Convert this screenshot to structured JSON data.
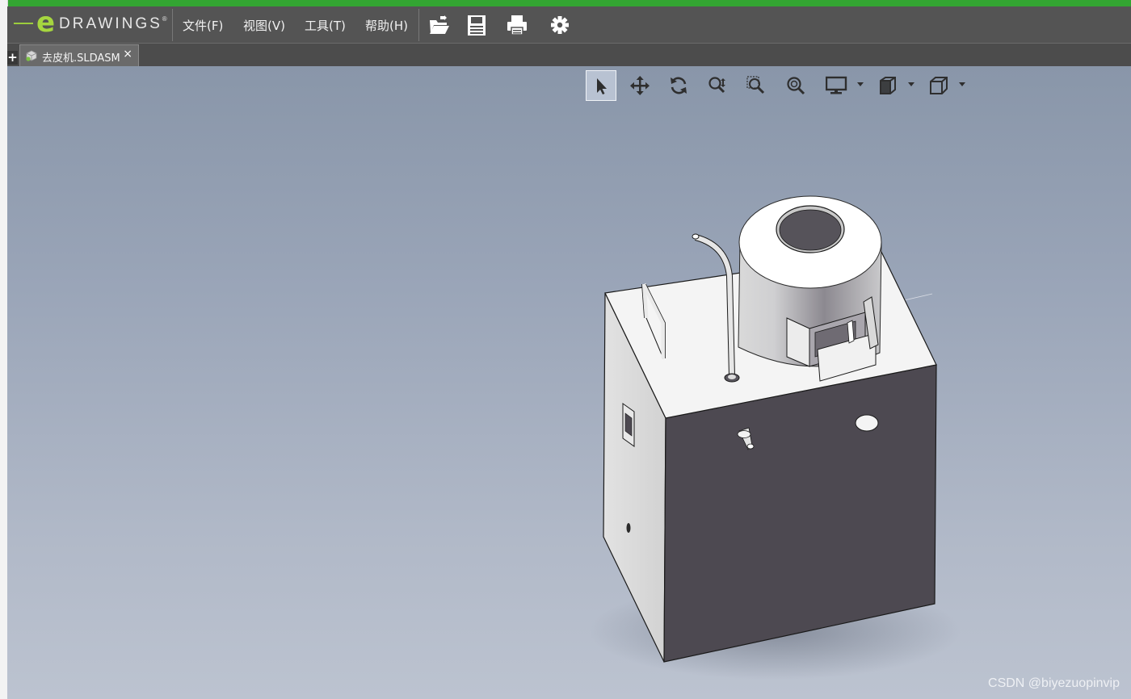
{
  "app": {
    "logo_letter": "e",
    "logo_text": "DRAWINGS",
    "logo_reg": "®"
  },
  "menu": {
    "file": "文件(F)",
    "view": "视图(V)",
    "tools": "工具(T)",
    "help": "帮助(H)"
  },
  "toolbar": {
    "icons": [
      "open-file-icon",
      "save-icon",
      "print-icon",
      "settings-gear-icon"
    ]
  },
  "tabs": {
    "add_label": "+",
    "document_name": "去皮机.SLDASM",
    "close_label": "×"
  },
  "view_tools": [
    "select-arrow-icon",
    "pan-icon",
    "rotate-icon",
    "zoom-icon",
    "zoom-to-area-icon",
    "zoom-to-fit-icon",
    "display-style-icon",
    "section-view-icon",
    "standard-views-cube-icon"
  ],
  "colors": {
    "menubar": "#545454",
    "logo_green": "#a6d63f",
    "viewport_top": "#8996a9",
    "viewport_bottom": "#bcc3d0",
    "model_dark_face": "#4d4951",
    "model_light_face": "#f2f2f2"
  },
  "watermark": "CSDN @biyezuopinvip"
}
